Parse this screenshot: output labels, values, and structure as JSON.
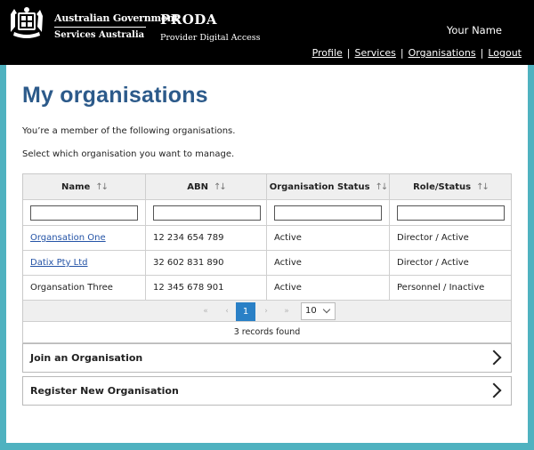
{
  "header": {
    "gov_line1": "Australian Government",
    "gov_line2": "Services Australia",
    "app_title": "PRODA",
    "app_subtitle": "Provider Digital Access",
    "user_name": "Your Name",
    "nav": [
      "Profile",
      "Services",
      "Organisations",
      "Logout"
    ]
  },
  "page": {
    "title": "My organisations",
    "intro1": "You’re a member of the following organisations.",
    "intro2": "Select which organisation you want to manage."
  },
  "table": {
    "columns": [
      "Name",
      "ABN",
      "Organisation Status",
      "Role/Status"
    ],
    "sort_glyph": "↑↓",
    "rows": [
      {
        "name": "Organsation One",
        "abn": "12 234 654 789",
        "status": "Active",
        "role": "Director / Active"
      },
      {
        "name": "Datix Pty Ltd",
        "abn": "32 602 831 890",
        "status": "Active",
        "role": "Director / Active"
      },
      {
        "name": "Organsation Three",
        "abn": "12 345 678 901",
        "status": "Active",
        "role": "Personnel / Inactive"
      }
    ],
    "pager": {
      "first": "«",
      "prev": "‹",
      "current_page": "1",
      "next": "›",
      "last": "»",
      "page_size": "10"
    },
    "records_found": "3 records found"
  },
  "actions": {
    "join": "Join an Organisation",
    "register": "Register New Organisation"
  },
  "colors": {
    "header_bg": "#000000",
    "page_bg": "#4fb2c0",
    "title": "#2c5a8a",
    "link": "#2453a6",
    "pager_active": "#2a80c6"
  }
}
